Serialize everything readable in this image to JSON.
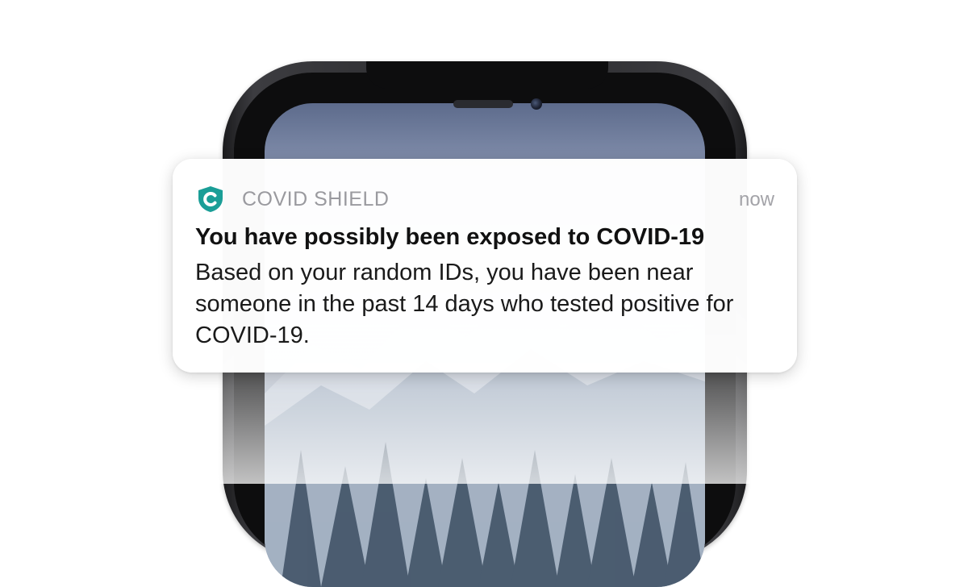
{
  "notification": {
    "app_name": "COVID SHIELD",
    "time": "now",
    "title": "You have possibly been exposed to COVID-19",
    "body": "Based on your random IDs, you have been near someone in the past 14 days who tested positive for COVID-19.",
    "icon": "shield-c-icon"
  },
  "colors": {
    "brand_teal": "#1a9e97",
    "app_name_gray": "#9a9a9f",
    "title_text": "#111111"
  },
  "device": {
    "wallpaper": "snowy-mountain-forest"
  }
}
